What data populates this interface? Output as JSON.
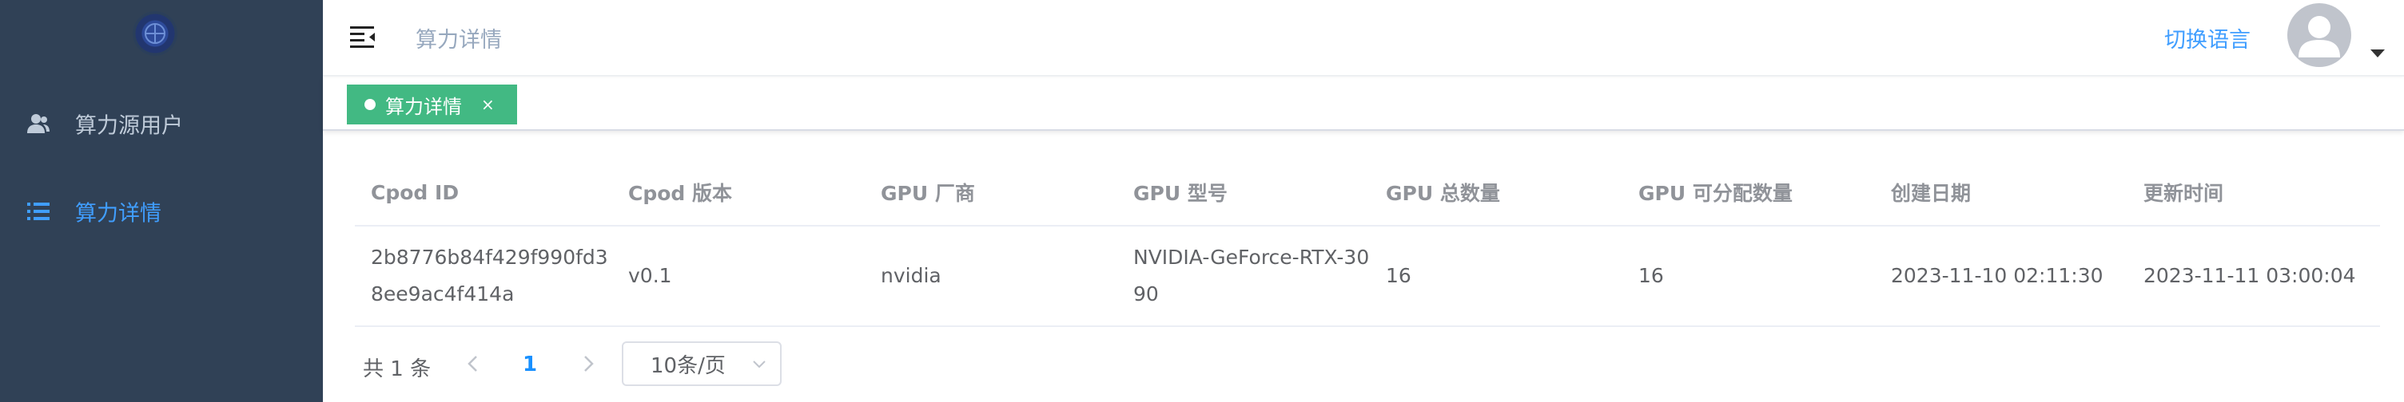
{
  "sidebar": {
    "items": [
      {
        "label": "算力源用户",
        "icon": "users-icon",
        "active": false
      },
      {
        "label": "算力详情",
        "icon": "list-icon",
        "active": true
      }
    ]
  },
  "header": {
    "breadcrumb": "算力详情",
    "language_switch": "切换语言",
    "avatar_icon": "user-avatar-icon"
  },
  "tags": [
    {
      "label": "算力详情",
      "close": "×",
      "color": "#42b983"
    }
  ],
  "table": {
    "columns": [
      "Cpod ID",
      "Cpod 版本",
      "GPU 厂商",
      "GPU 型号",
      "GPU 总数量",
      "GPU 可分配数量",
      "创建日期",
      "更新时间"
    ],
    "rows": [
      [
        "2b8776b84f429f990fd38ee9ac4f414a",
        "v0.1",
        "nvidia",
        "NVIDIA-GeForce-RTX-3090",
        "16",
        "16",
        "2023-11-10 02:11:30",
        "2023-11-11 03:00:04"
      ]
    ]
  },
  "pagination": {
    "total_text": "共 1 条",
    "current_page": "1",
    "page_size": "10条/页"
  },
  "colors": {
    "sidebar_bg": "#304156",
    "sidebar_text": "#bfcbd9",
    "active": "#409eff",
    "tag_green": "#42b983"
  }
}
